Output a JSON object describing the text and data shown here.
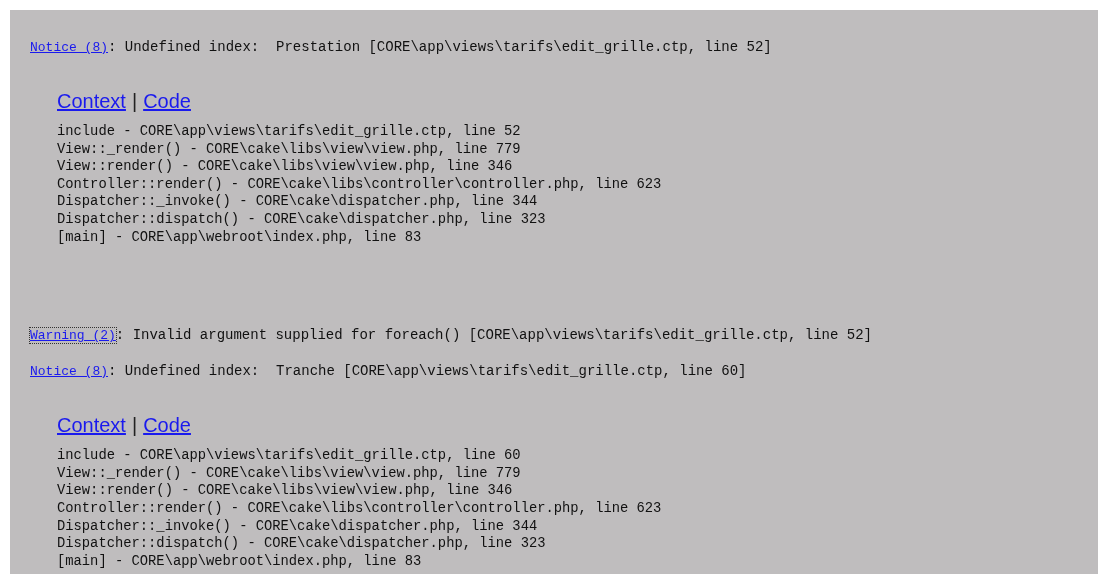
{
  "errors": [
    {
      "link": "Notice (8)",
      "focused": false,
      "message": ": Undefined index:  Prestation [CORE\\app\\views\\tarifs\\edit_grille.ctp, line 52]",
      "context": "Context",
      "separator": "|",
      "code": "Code",
      "trace": [
        "include - CORE\\app\\views\\tarifs\\edit_grille.ctp, line 52",
        "View::_render() - CORE\\cake\\libs\\view\\view.php, line 779",
        "View::render() - CORE\\cake\\libs\\view\\view.php, line 346",
        "Controller::render() - CORE\\cake\\libs\\controller\\controller.php, line 623",
        "Dispatcher::_invoke() - CORE\\cake\\dispatcher.php, line 344",
        "Dispatcher::dispatch() - CORE\\cake\\dispatcher.php, line 323",
        "[main] - CORE\\app\\webroot\\index.php, line 83"
      ]
    },
    {
      "link": "Warning (2)",
      "focused": true,
      "message": ": Invalid argument supplied for foreach() [CORE\\app\\views\\tarifs\\edit_grille.ctp, line 52]"
    },
    {
      "link": "Notice (8)",
      "focused": false,
      "message": ": Undefined index:  Tranche [CORE\\app\\views\\tarifs\\edit_grille.ctp, line 60]",
      "context": "Context",
      "separator": "|",
      "code": "Code",
      "trace": [
        "include - CORE\\app\\views\\tarifs\\edit_grille.ctp, line 60",
        "View::_render() - CORE\\cake\\libs\\view\\view.php, line 779",
        "View::render() - CORE\\cake\\libs\\view\\view.php, line 346",
        "Controller::render() - CORE\\cake\\libs\\controller\\controller.php, line 623",
        "Dispatcher::_invoke() - CORE\\cake\\dispatcher.php, line 344",
        "Dispatcher::dispatch() - CORE\\cake\\dispatcher.php, line 323",
        "[main] - CORE\\app\\webroot\\index.php, line 83"
      ]
    }
  ]
}
